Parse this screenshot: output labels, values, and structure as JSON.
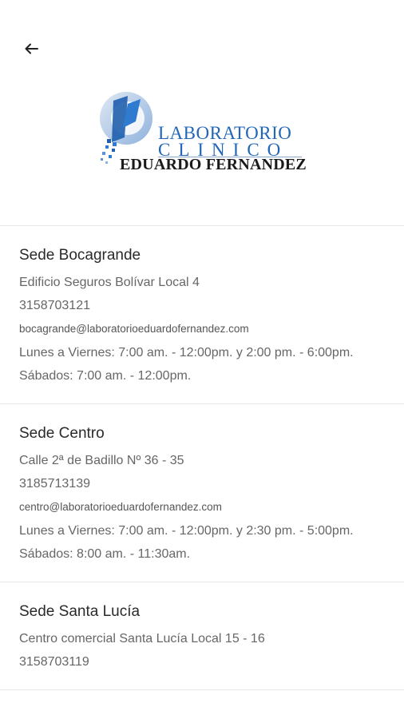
{
  "header": {
    "back_icon": "arrow-left-icon"
  },
  "logo": {
    "line1": "LABORATORIO",
    "line2": "CLINICO",
    "line3": "EDUARDO FERNANDEZ",
    "colors": {
      "primary": "#2266b8",
      "dark": "#1a1a1a"
    }
  },
  "sedes": [
    {
      "title": "Sede Bocagrande",
      "address": "Edificio Seguros Bolívar Local 4",
      "phone": "3158703121",
      "email": "bocagrande@laboratorioeduardofernandez.com",
      "weekdays": "Lunes a Viernes: 7:00 am. - 12:00pm. y 2:00 pm. - 6:00pm.",
      "saturday": "Sábados: 7:00 am. - 12:00pm."
    },
    {
      "title": "Sede Centro",
      "address": "Calle 2ª de Badillo Nº 36 - 35",
      "phone": "3185713139",
      "email": "centro@laboratorioeduardofernandez.com",
      "weekdays": "Lunes a Viernes: 7:00 am. - 12:00pm. y 2:30 pm. - 5:00pm.",
      "saturday": "Sábados: 8:00 am. - 11:30am."
    },
    {
      "title": "Sede Santa Lucía",
      "address": "Centro comercial Santa Lucía Local 15 - 16",
      "phone": "3158703119"
    }
  ]
}
